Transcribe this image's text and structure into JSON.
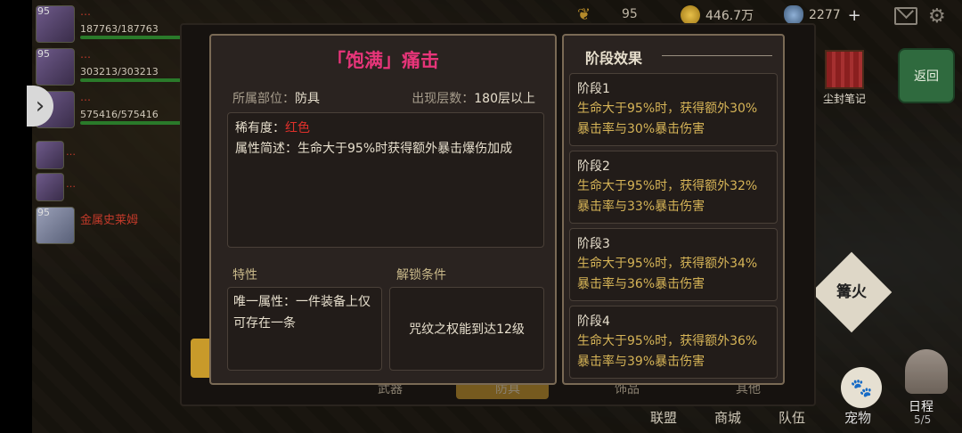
{
  "topbar": {
    "wheat_value": "95",
    "gold_value": "446.7万",
    "gem_value": "2277",
    "gem_add": "+"
  },
  "party": [
    {
      "level": "95",
      "name": "…",
      "hp": "187763/187763"
    },
    {
      "level": "95",
      "name": "…",
      "hp": "303213/303213"
    },
    {
      "level": "95",
      "name": "…",
      "hp": "575416/575416"
    },
    {
      "level": "",
      "name": "…"
    },
    {
      "level": "",
      "name": "…"
    },
    {
      "level": "95",
      "name": "金属史莱姆"
    }
  ],
  "right_buttons": {
    "dust_notes": "尘封笔记",
    "back": "返回",
    "campfire": "篝火",
    "pet": "宠物",
    "schedule": "日程",
    "schedule_count": "5/5"
  },
  "bottom_nav": {
    "alliance": "联盟",
    "shop": "商城",
    "team": "队伍"
  },
  "equip_tabs": {
    "weapon": "武器",
    "armor": "防具",
    "accessory": "饰品",
    "other": "其他"
  },
  "item": {
    "title": "「饱满」痛击",
    "slot_label": "所属部位：",
    "slot_value": "防具",
    "floor_label": "出现层数：",
    "floor_value": "180层以上",
    "rarity_label": "稀有度：",
    "rarity_value": "红色",
    "desc_text": "属性简述：生命大于95%时获得额外暴击爆伤加成",
    "trait_heading": "特性",
    "unlock_heading": "解锁条件",
    "trait_text": "唯一属性：一件装备上仅可存在一条",
    "unlock_text": "咒纹之权能到达12级"
  },
  "stages": {
    "heading": "阶段效果",
    "items": [
      {
        "title": "阶段1",
        "desc": "生命大于95%时，获得额外30%暴击率与30%暴击伤害"
      },
      {
        "title": "阶段2",
        "desc": "生命大于95%时，获得额外32%暴击率与33%暴击伤害"
      },
      {
        "title": "阶段3",
        "desc": "生命大于95%时，获得额外34%暴击率与36%暴击伤害"
      },
      {
        "title": "阶段4",
        "desc": "生命大于95%时，获得额外36%暴击率与39%暴击伤害"
      }
    ]
  },
  "colors": {
    "title_pink": "#e8357a",
    "rarity_red": "#e0302a",
    "stage_desc_gold": "#d6b457",
    "back_green": "#2f6a3e"
  }
}
